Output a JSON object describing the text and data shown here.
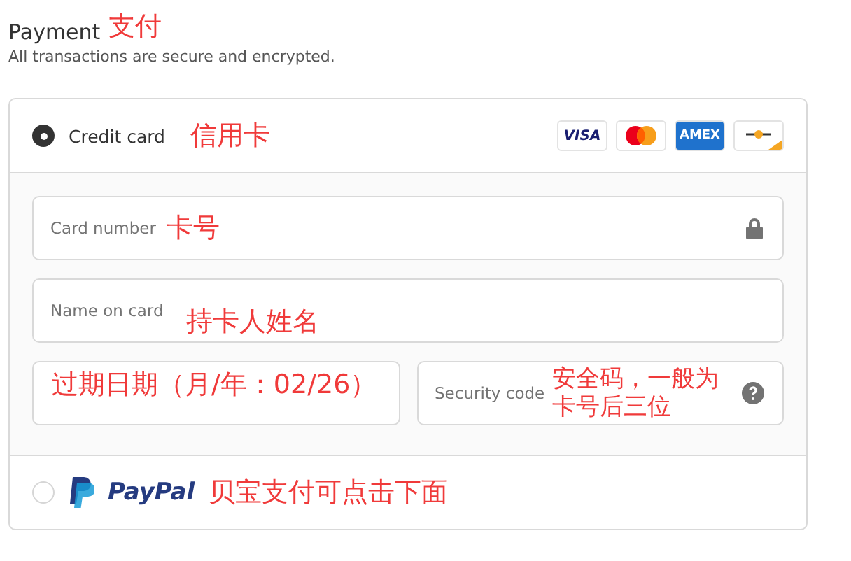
{
  "heading": {
    "title": "Payment",
    "note": "支付"
  },
  "subtitle": "All transactions are secure and encrypted.",
  "methods": [
    {
      "kind": "card",
      "label": "Credit card",
      "selected": true,
      "note": "信用卡",
      "brands": [
        {
          "kind": "visa",
          "text": "VISA"
        },
        {
          "kind": "mastercard"
        },
        {
          "kind": "amex",
          "text": "AMEX"
        },
        {
          "kind": "other"
        }
      ],
      "field_rows": [
        [
          {
            "kind": "card_number",
            "placeholder": "Card number",
            "note": "卡号"
          }
        ],
        [
          {
            "kind": "name",
            "placeholder": "Name on card",
            "note": "持卡人姓名"
          }
        ],
        [
          {
            "kind": "expiry",
            "note": "过期日期（月/年：02/26）"
          },
          {
            "kind": "security_code",
            "placeholder": "Security code",
            "note": "安全码，一般为卡号后三位"
          }
        ]
      ]
    },
    {
      "kind": "paypal",
      "label": "PayPal",
      "selected": false,
      "note": "贝宝支付可点击下面"
    }
  ]
}
